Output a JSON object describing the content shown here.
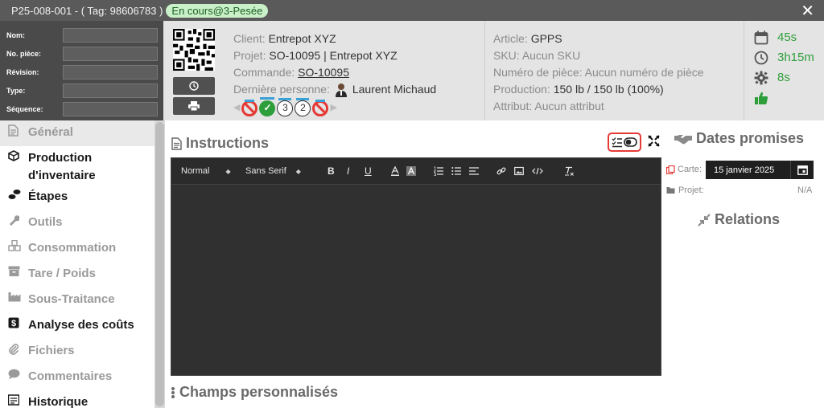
{
  "window": {
    "title": "P25-008-001 - ( Tag: 98606783 )",
    "status_badge": "En cours@3-Pesée",
    "close": "✕"
  },
  "id_fields": [
    {
      "label": "Nom:",
      "value": ""
    },
    {
      "label": "No. pièce:",
      "value": ""
    },
    {
      "label": "Révision:",
      "value": ""
    },
    {
      "label": "Type:",
      "value": ""
    },
    {
      "label": "Séquence:",
      "value": ""
    }
  ],
  "info": {
    "client_label": "Client:",
    "client": "Entrepot XYZ",
    "project_label": "Projet:",
    "project": "SO-10095 | Entrepot XYZ",
    "order_label": "Commande:",
    "order": "SO-10095",
    "last_person_label": "Dernière personne:",
    "last_person": "Laurent Michaud",
    "status_numbers": [
      "3",
      "2"
    ]
  },
  "article": {
    "article_label": "Article:",
    "article": "GPPS",
    "sku_label": "SKU:",
    "sku": "Aucun SKU",
    "part_label": "Numéro de pièce:",
    "part": "Aucun numéro de pièce",
    "production_label": "Production:",
    "production": "150 lb / 150 lb (100%)",
    "attribute_label": "Attribut:",
    "attribute": "Aucun attribut"
  },
  "times": {
    "calendar": "45s",
    "clock": "3h15m",
    "gear": "8s"
  },
  "nav": [
    {
      "label": "Général",
      "icon": "document-icon"
    },
    {
      "label": "Production d'inventaire",
      "icon": "cube-icon"
    },
    {
      "label": "Étapes",
      "icon": "footsteps-icon"
    },
    {
      "label": "Outils",
      "icon": "wrench-icon"
    },
    {
      "label": "Consommation",
      "icon": "cubes-icon"
    },
    {
      "label": "Tare / Poids",
      "icon": "archive-icon"
    },
    {
      "label": "Sous-Traitance",
      "icon": "factory-icon"
    },
    {
      "label": "Analyse des coûts",
      "icon": "dollar-icon"
    },
    {
      "label": "Fichiers",
      "icon": "paperclip-icon"
    },
    {
      "label": "Commentaires",
      "icon": "comment-icon"
    },
    {
      "label": "Historique",
      "icon": "history-icon"
    }
  ],
  "main": {
    "instructions_title": "Instructions",
    "custom_fields_title": "Champs personnalisés",
    "editor": {
      "format": "Normal",
      "font": "Sans Serif",
      "content": ""
    }
  },
  "right": {
    "promised_title": "Dates promises",
    "card_label": "Carte:",
    "card_date": "15 janvier 2025",
    "project_label": "Projet:",
    "project_value": "N/A",
    "relations_title": "Relations"
  },
  "colors": {
    "accent_green": "#2e9e3a",
    "red": "#e53935",
    "titlebar": "#5a5a5a",
    "header_dark": "#4a4a4a"
  }
}
